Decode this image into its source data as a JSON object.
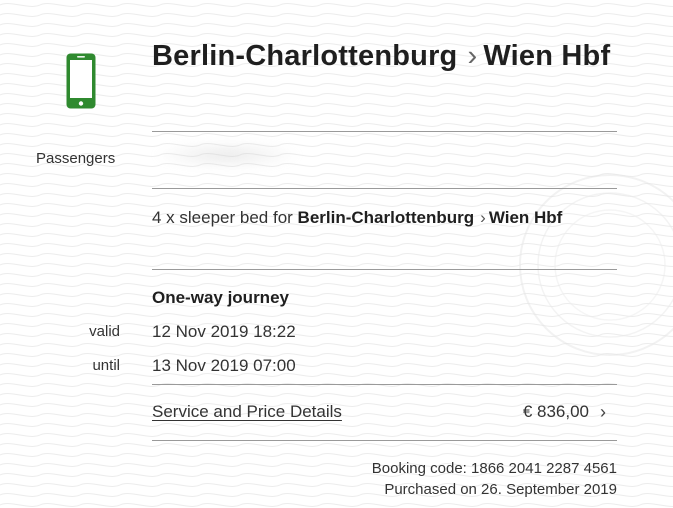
{
  "ticket": {
    "route": {
      "origin": "Berlin-Charlottenburg",
      "separator": "›",
      "destination": "Wien Hbf"
    },
    "passengers": {
      "label": "Passengers"
    },
    "offer": {
      "prefix": "4 x sleeper bed for",
      "origin": "Berlin-Charlottenburg",
      "separator": "›",
      "destination": "Wien Hbf"
    },
    "journey_type": "One-way journey",
    "validity": {
      "valid_label": "valid",
      "valid_value": "12 Nov 2019 18:22",
      "until_label": "until",
      "until_value": "13 Nov 2019 07:00"
    },
    "details": {
      "link_label": "Service and Price Details",
      "price": "€ 836,00",
      "chevron": "›"
    },
    "footer": {
      "booking_code": "Booking code: 1866 2041 2287 4561",
      "purchased": "Purchased on 26. September 2019"
    }
  },
  "icons": {
    "device_icon": "smartphone-icon",
    "accent_color": "#2f8a2f"
  }
}
